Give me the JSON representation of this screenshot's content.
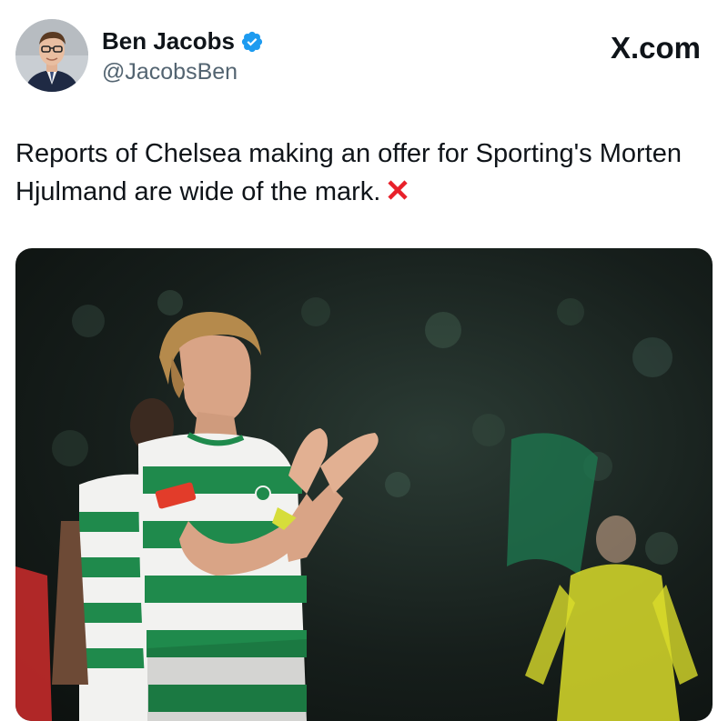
{
  "author": {
    "name": "Ben Jacobs",
    "handle": "@JacobsBen",
    "verified": true,
    "avatar_icon": "profile-photo"
  },
  "site": {
    "logo_text": "X.com"
  },
  "tweet": {
    "text": "Reports of Chelsea making an offer for Sporting's Morten Hjulmand are wide of the mark.",
    "emoji": "cross-mark-icon"
  },
  "media": {
    "kind": "photo",
    "description_icon": "football-player-photo",
    "colors": {
      "kit_green": "#1f8a4c",
      "kit_white": "#f2f2f0",
      "keeper_yellow": "#d9dc2a"
    }
  }
}
